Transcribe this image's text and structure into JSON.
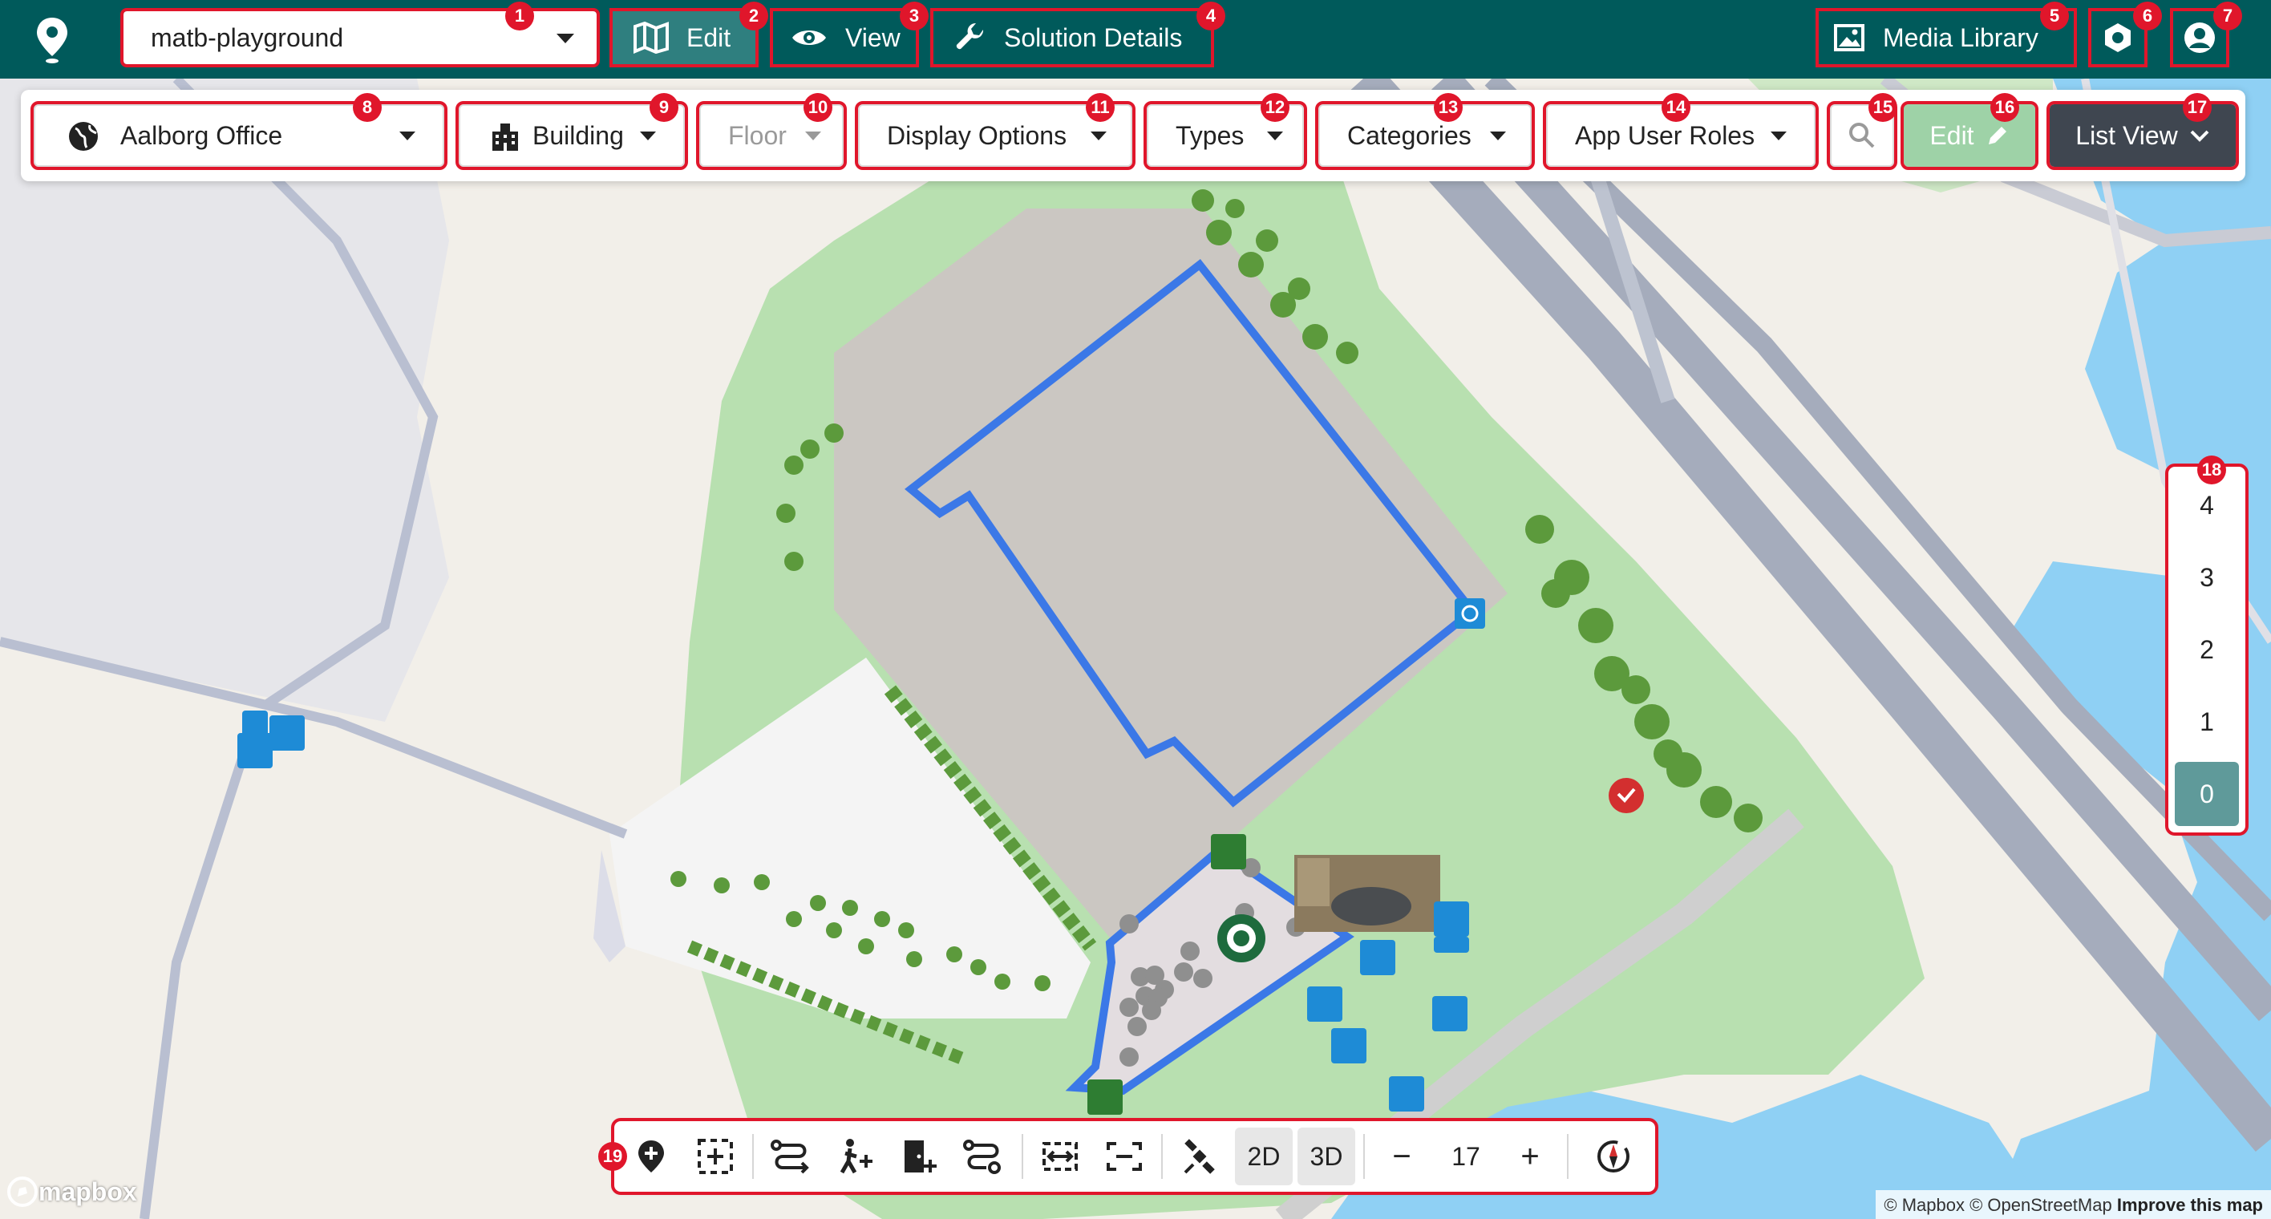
{
  "topbar": {
    "solution": "matb-playground",
    "edit_label": "Edit",
    "view_label": "View",
    "solution_details_label": "Solution Details",
    "media_library_label": "Media Library"
  },
  "toolbar": {
    "venue": "Aalborg Office",
    "building": "Building",
    "floor": "Floor",
    "display_options": "Display Options",
    "types": "Types",
    "categories": "Categories",
    "app_user_roles": "App User Roles",
    "edit_label": "Edit",
    "list_view_label": "List View"
  },
  "floors": [
    "4",
    "3",
    "2",
    "1",
    "0"
  ],
  "active_floor": "0",
  "controls": {
    "mode_2d": "2D",
    "mode_3d": "3D",
    "zoom": "17",
    "zoom_out": "−",
    "zoom_in": "+"
  },
  "badges": [
    "1",
    "2",
    "3",
    "4",
    "5",
    "6",
    "7",
    "8",
    "9",
    "10",
    "11",
    "12",
    "13",
    "14",
    "15",
    "16",
    "17",
    "18",
    "19"
  ],
  "attribution": {
    "mapbox_logo": "mapbox",
    "text": "© Mapbox © OpenStreetMap",
    "improve": "Improve this map"
  },
  "colors": {
    "topbar": "#005a5b",
    "highlight": "#e0162b",
    "building_outline": "#3b78e7",
    "park": "#b8e0b0",
    "water": "#8fd0f4"
  }
}
